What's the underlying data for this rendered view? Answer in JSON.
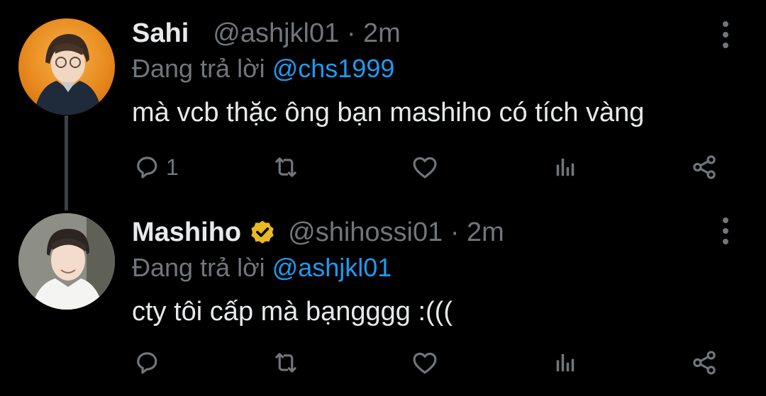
{
  "tweets": [
    {
      "display_name": "Sahi",
      "handle": "@ashjkl01",
      "separator": "·",
      "time": "2m",
      "reply_prefix": "Đang trả lời",
      "reply_to": "@chs1999",
      "text": "mà vcb thặc ông bạn mashiho có tích vàng",
      "reply_count": "1",
      "verified": false
    },
    {
      "display_name": "Mashiho",
      "handle": "@shihossi01",
      "separator": "·",
      "time": "2m",
      "reply_prefix": "Đang trả lời",
      "reply_to": "@ashjkl01",
      "text": "cty tôi cấp mà bạngggg :(((",
      "reply_count": "",
      "verified": true
    }
  ],
  "icons": {
    "reply": "speech-bubble-icon",
    "retweet": "retweet-icon",
    "like": "heart-icon",
    "views": "bar-chart-icon",
    "share": "share-icon",
    "more": "vertical-ellipsis-icon",
    "verified": "gold-verified-badge-icon"
  },
  "colors": {
    "background": "#000000",
    "text": "#e7e9ea",
    "muted": "#71767b",
    "link": "#1d9bf0",
    "verified_gold": "#e8b923"
  }
}
